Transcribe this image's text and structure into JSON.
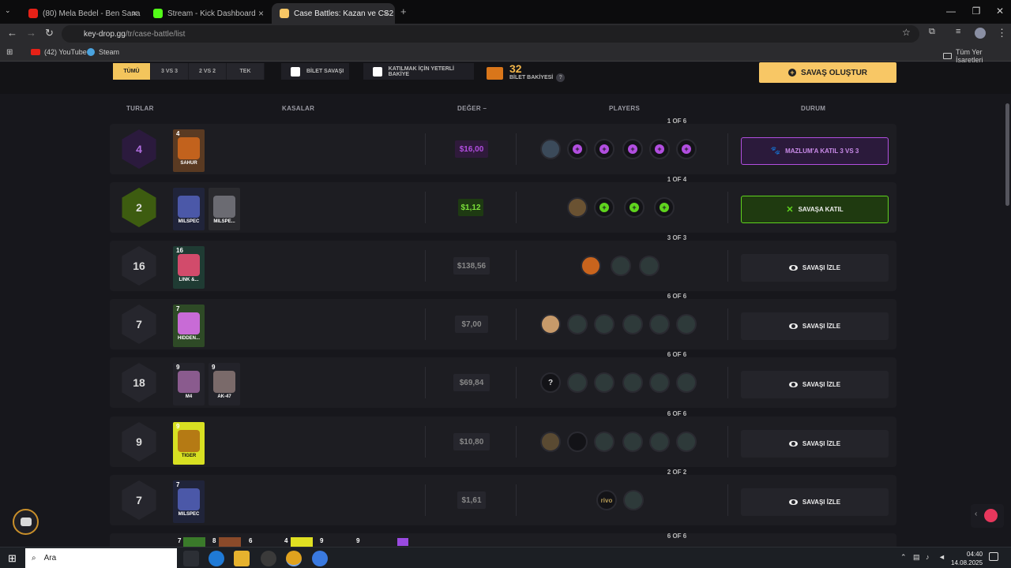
{
  "browser": {
    "tabs": [
      {
        "title": "(80) Mela Bedel - Ben Sana",
        "active": false
      },
      {
        "title": "Stream - Kick Dashboard",
        "active": false
      },
      {
        "title": "Case Battles: Kazan ve CS2 (CS",
        "active": true
      }
    ],
    "url_host": "key-drop.gg",
    "url_path": "/tr/case-battle/list",
    "bookmarks": [
      "(42) YouTube",
      "Steam"
    ],
    "all_bookmarks": "Tüm Yer İşaretleri"
  },
  "filters": {
    "modes": [
      "TÜMÜ",
      "3 VS 3",
      "2 VS 2",
      "TEK"
    ],
    "ticket_battle": "BİLET SAVAŞI",
    "enough_balance": "KATILMAK İÇİN YETERLİ BAKİYE",
    "ticket_count": "32",
    "ticket_label": "BİLET BAKİYESİ",
    "help": "?",
    "create": "SAVAŞ OLUŞTUR"
  },
  "headers": {
    "rounds": "TURLAR",
    "cases": "KASALAR",
    "value": "DEĞER",
    "players": "PLAYERS",
    "status": "DURUM"
  },
  "battles": [
    {
      "rounds": "4",
      "cases": [
        {
          "count": "4",
          "name": "SAHUR"
        }
      ],
      "value": "$16,00",
      "players": "1 OF 6",
      "status": "MAZLUM'A KATIL 3 VS 3"
    },
    {
      "rounds": "2",
      "cases": [
        {
          "count": "",
          "name": "MILSPEC"
        },
        {
          "count": "",
          "name": "MILSPE..."
        }
      ],
      "value": "$1,12",
      "players": "1 OF 4",
      "status": "SAVAŞA KATIL"
    },
    {
      "rounds": "16",
      "cases": [
        {
          "count": "16",
          "name": "LINK &..."
        }
      ],
      "value": "$138,56",
      "players": "3 OF 3",
      "status": "SAVAŞI İZLE"
    },
    {
      "rounds": "7",
      "cases": [
        {
          "count": "7",
          "name": "HIDDEN..."
        }
      ],
      "value": "$7,00",
      "players": "6 OF 6",
      "status": "SAVAŞI İZLE"
    },
    {
      "rounds": "18",
      "cases": [
        {
          "count": "9",
          "name": "M4"
        },
        {
          "count": "9",
          "name": "AK-47"
        }
      ],
      "value": "$69,84",
      "players": "6 OF 6",
      "status": "SAVAŞI İZLE",
      "unknown": "?"
    },
    {
      "rounds": "9",
      "cases": [
        {
          "count": "9",
          "name": "TIGER"
        }
      ],
      "value": "$10,80",
      "players": "6 OF 6",
      "status": "SAVAŞI İZLE"
    },
    {
      "rounds": "7",
      "cases": [
        {
          "count": "7",
          "name": "MILSPEC"
        }
      ],
      "value": "$1,61",
      "players": "2 OF 2",
      "status": "SAVAŞI İZLE",
      "rivo": "rivo"
    },
    {
      "players": "6 OF 6",
      "counts": [
        "7",
        "8",
        "6",
        "4",
        "9",
        "9"
      ]
    }
  ],
  "taskbar": {
    "search": "Ara",
    "time": "04:40",
    "date": "14.08.2025"
  },
  "colors": {
    "accent": "#f8c765",
    "purple": "#b24ee0",
    "green": "#5fd41e"
  }
}
